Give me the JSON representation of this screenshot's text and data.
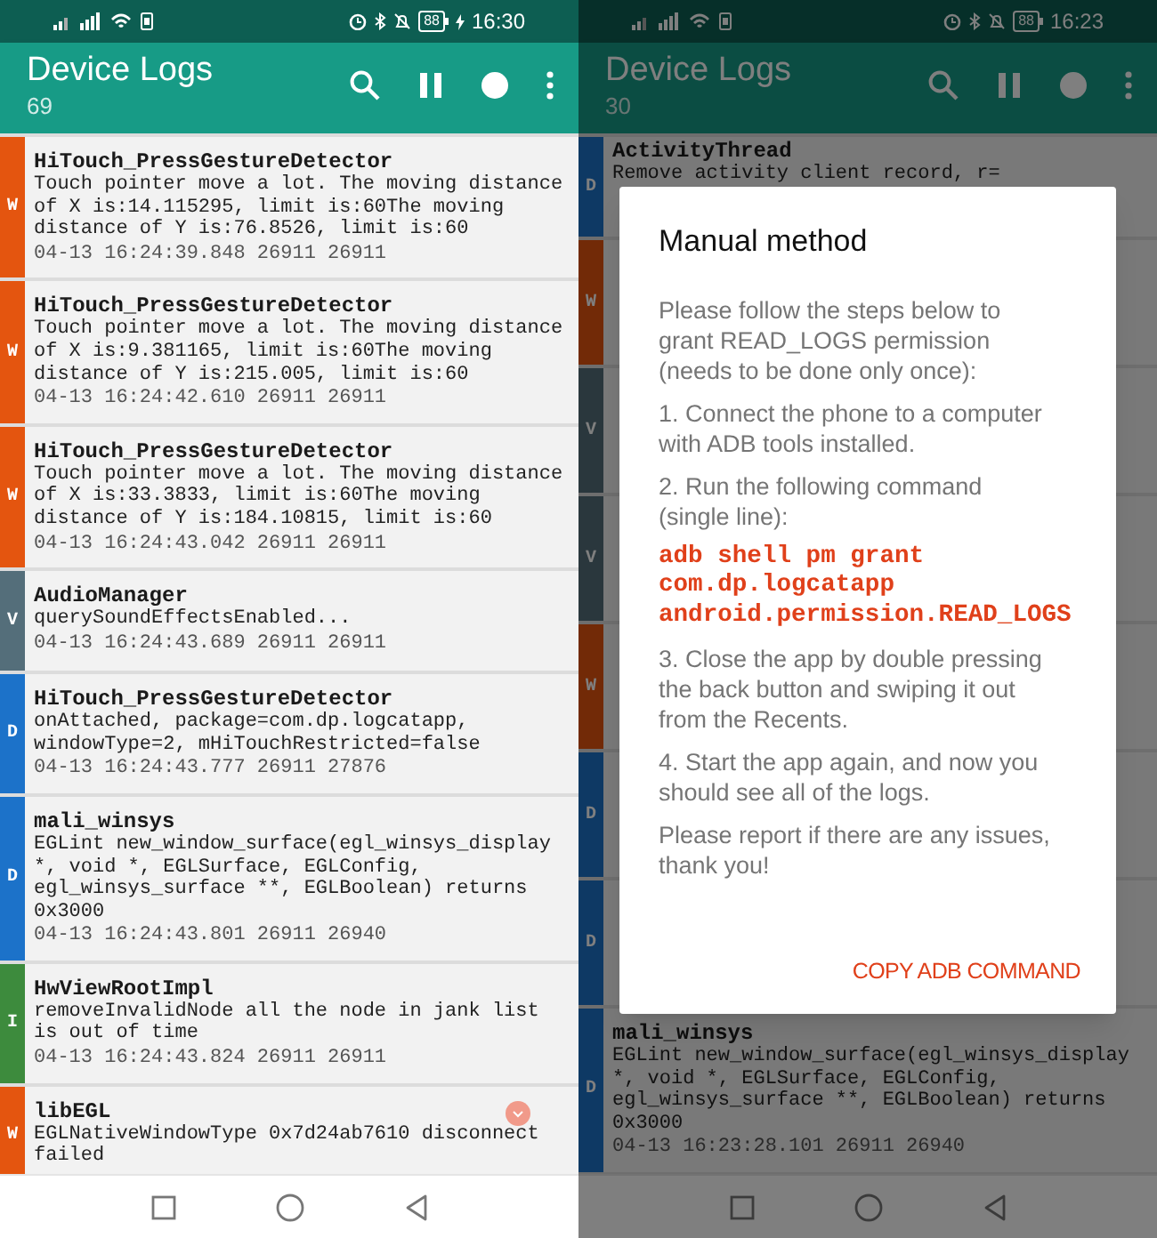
{
  "screens": [
    {
      "status_bar": {
        "battery": "88",
        "time": "16:30",
        "charging": true
      },
      "app_bar": {
        "title": "Device Logs",
        "count": "69"
      },
      "logs": [
        {
          "level": "W",
          "tag": "HiTouch_PressGestureDetector",
          "message": "Touch pointer move a lot. The moving distance of X is:14.115295, limit is:60The moving distance of Y is:76.8526, limit is:60",
          "meta": "04-13 16:24:39.848 26911 26911"
        },
        {
          "level": "W",
          "tag": "HiTouch_PressGestureDetector",
          "message": "Touch pointer move a lot. The moving distance of X is:9.381165, limit is:60The moving distance of Y is:215.005, limit is:60",
          "meta": "04-13 16:24:42.610 26911 26911"
        },
        {
          "level": "W",
          "tag": "HiTouch_PressGestureDetector",
          "message": "Touch pointer move a lot. The moving distance of X is:33.3833, limit is:60The moving distance of Y is:184.10815, limit is:60",
          "meta": "04-13 16:24:43.042 26911 26911"
        },
        {
          "level": "V",
          "tag": "AudioManager",
          "message": "querySoundEffectsEnabled...",
          "meta": "04-13 16:24:43.689 26911 26911"
        },
        {
          "level": "D",
          "tag": "HiTouch_PressGestureDetector",
          "message": "onAttached, package=com.dp.logcatapp, windowType=2, mHiTouchRestricted=false",
          "meta": "04-13 16:24:43.777 26911 27876"
        },
        {
          "level": "D",
          "tag": "mali_winsys",
          "message": "EGLint new_window_surface(egl_winsys_display *, void *, EGLSurface, EGLConfig, egl_winsys_surface **, EGLBoolean) returns 0x3000",
          "meta": "04-13 16:24:43.801 26911 26940"
        },
        {
          "level": "I",
          "tag": "HwViewRootImpl",
          "message": "removeInvalidNode all the node in jank list is out of time",
          "meta": "04-13 16:24:43.824 26911 26911"
        },
        {
          "level": "W",
          "tag": "libEGL",
          "message": "EGLNativeWindowType 0x7d24ab7610 disconnect failed"
        }
      ],
      "scroll_button": true
    },
    {
      "status_bar": {
        "battery": "88",
        "time": "16:23",
        "charging": false
      },
      "app_bar": {
        "title": "Device Logs",
        "count": "30"
      },
      "logs": [
        {
          "level": "D",
          "tag": "ActivityThread",
          "message": "Remove activity client record, r="
        },
        {
          "level": "W"
        },
        {
          "level": "V"
        },
        {
          "level": "V"
        },
        {
          "level": "W"
        },
        {
          "level": "D"
        },
        {
          "level": "D"
        },
        {
          "level": "D",
          "tag": "mali_winsys",
          "message": "EGLint new_window_surface(egl_winsys_display *, void *, EGLSurface, EGLConfig, egl_winsys_surface **, EGLBoolean) returns 0x3000",
          "meta": "04-13 16:23:28.101 26911 26940"
        }
      ],
      "dialog": {
        "title": "Manual method",
        "paragraphs": [
          {
            "kind": "text",
            "text": "Please follow the steps below to grant READ_LOGS permission (needs to be done only once):"
          },
          {
            "kind": "text",
            "text": "1. Connect the phone to a computer with ADB tools installed."
          },
          {
            "kind": "text",
            "text": "2. Run the following command (single line):"
          },
          {
            "kind": "code",
            "text": "adb shell pm grant com.dp.logcatapp android.permission.READ_LOGS"
          },
          {
            "kind": "text",
            "text": "3. Close the app by double pressing the back button and swiping it out from the Recents."
          },
          {
            "kind": "text",
            "text": "4. Start the app again, and now you should see all of the logs."
          },
          {
            "kind": "text",
            "text": "Please report if there are any issues, thank you!"
          }
        ],
        "button": "COPY ADB COMMAND"
      }
    }
  ]
}
